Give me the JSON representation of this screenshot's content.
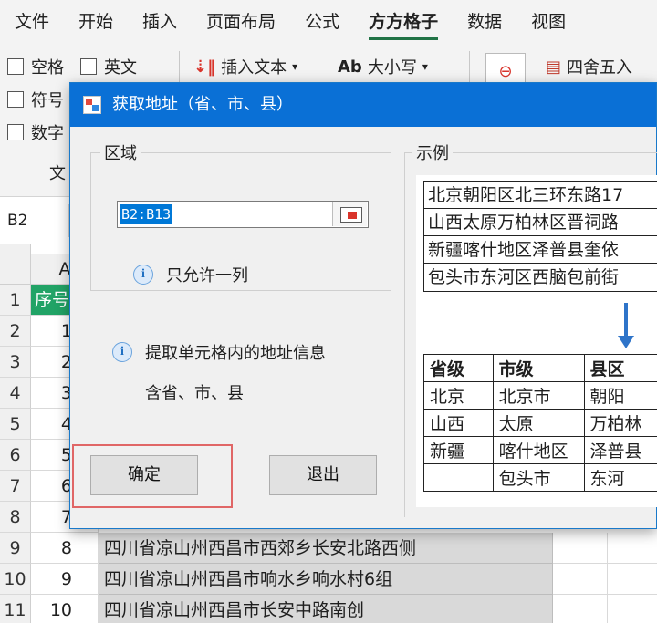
{
  "menubar": [
    "文件",
    "开始",
    "插入",
    "页面布局",
    "公式",
    "方方格子",
    "数据",
    "视图"
  ],
  "ribbon": {
    "space": "空格",
    "english": "英文",
    "symbol": "符号",
    "number": "数字",
    "insert_text": "插入文本",
    "case": "大小写",
    "case_icon": "Ab",
    "round": "四舍五入",
    "group_label": "文"
  },
  "name_box": "B2",
  "grid": {
    "col_a": "A",
    "header_cell": "序号",
    "rows": [
      {
        "num": "1",
        "a": ""
      },
      {
        "num": "2",
        "a": "1"
      },
      {
        "num": "3",
        "a": "2"
      },
      {
        "num": "4",
        "a": "3"
      },
      {
        "num": "5",
        "a": "4"
      },
      {
        "num": "6",
        "a": "5"
      },
      {
        "num": "7",
        "a": "6"
      },
      {
        "num": "8",
        "a": "7"
      },
      {
        "num": "9",
        "a": "8",
        "b": "四川省凉山州西昌市西郊乡长安北路西侧"
      },
      {
        "num": "10",
        "a": "9",
        "b": "四川省凉山州西昌市响水乡响水村6组"
      },
      {
        "num": "11",
        "a": "10",
        "b": "四川省凉山州西昌市长安中路南创"
      }
    ]
  },
  "dialog": {
    "title": "获取地址（省、市、县）",
    "area_label": "区域",
    "range_value": "B2:B13",
    "only_one_column": "只允许一列",
    "extract_info": "提取单元格内的地址信息",
    "contains": "含省、市、县",
    "ok": "确定",
    "exit": "退出",
    "example_label": "示例",
    "example_sources": [
      "北京朝阳区北三环东路17",
      "山西太原万柏林区晋祠路",
      "新疆喀什地区泽普县奎依",
      "包头市东河区西脑包前街"
    ],
    "example_headers": [
      "省级",
      "市级",
      "县区"
    ],
    "example_rows": [
      [
        "北京",
        "北京市",
        "朝阳"
      ],
      [
        "山西",
        "太原",
        "万柏林"
      ],
      [
        "新疆",
        "喀什地区",
        "泽普县"
      ],
      [
        "",
        "包头市",
        "东河"
      ]
    ]
  }
}
